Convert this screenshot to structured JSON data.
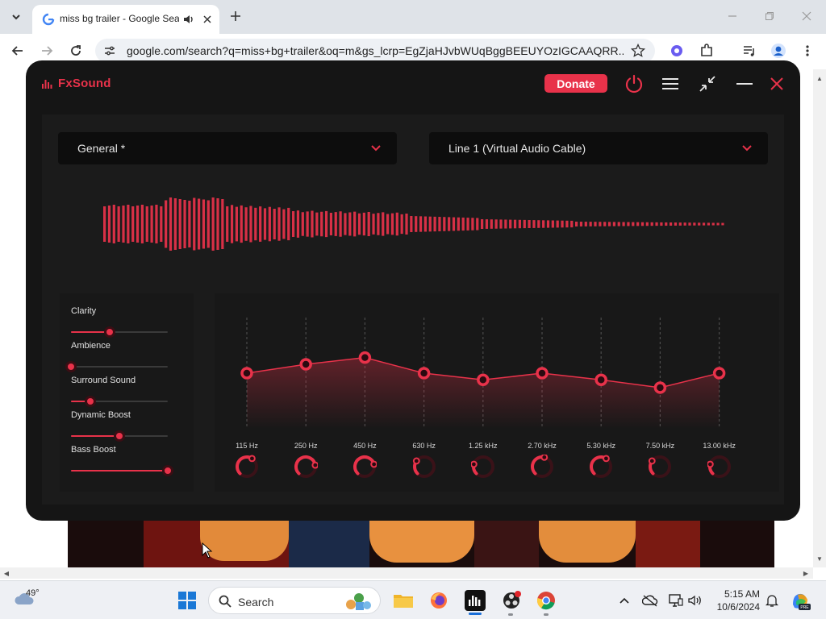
{
  "browser": {
    "tab": {
      "title": "miss bg trailer - Google Search",
      "favicon": "google-g-icon",
      "audio_icon": "speaker-icon"
    },
    "address": "google.com/search?q=miss+bg+trailer&oq=m&gs_lcrp=EgZjaHJvbWUqBggBEEUYOzIGCAAQRR...",
    "toolbar_icons": [
      "back-icon",
      "forward-icon",
      "reload-icon",
      "site-info-icon",
      "bookmark-star-icon",
      "extension-icon",
      "puzzle-icon",
      "media-icon",
      "profile-icon",
      "more-icon"
    ]
  },
  "fxsound": {
    "logo": "FxSound",
    "donate": "Donate",
    "preset": "General *",
    "output_device": "Line 1 (Virtual Audio Cable)",
    "effects": [
      {
        "label": "Clarity",
        "value": 0.4
      },
      {
        "label": "Ambience",
        "value": 0.0
      },
      {
        "label": "Surround Sound",
        "value": 0.2
      },
      {
        "label": "Dynamic Boost",
        "value": 0.5
      },
      {
        "label": "Bass Boost",
        "value": 1.0
      }
    ],
    "eq_bands": [
      {
        "label": "115 Hz",
        "level": 0.5,
        "knob": 0.62
      },
      {
        "label": "250 Hz",
        "level": 0.58,
        "knob": 0.8
      },
      {
        "label": "450 Hz",
        "level": 0.64,
        "knob": 0.78
      },
      {
        "label": "630 Hz",
        "level": 0.5,
        "knob": 0.3
      },
      {
        "label": "1.25 kHz",
        "level": 0.44,
        "knob": 0.22
      },
      {
        "label": "2.70 kHz",
        "level": 0.5,
        "knob": 0.55
      },
      {
        "label": "5.30 kHz",
        "level": 0.44,
        "knob": 0.62
      },
      {
        "label": "7.50 kHz",
        "level": 0.37,
        "knob": 0.3
      },
      {
        "label": "13.00 kHz",
        "level": 0.5,
        "knob": 0.22
      }
    ],
    "accent": "#e8324a"
  },
  "taskbar": {
    "temperature": "49°",
    "search": "Search",
    "time": "5:15 AM",
    "date": "10/6/2024",
    "apps": [
      "start-icon",
      "search-icon",
      "file-explorer-icon",
      "firefox-icon",
      "fxsound-icon",
      "obs-icon",
      "chrome-icon"
    ],
    "tray": [
      "chevron-up-icon",
      "onedrive-icon",
      "display-icon",
      "volume-icon",
      "notification-icon",
      "copilot-icon"
    ]
  }
}
